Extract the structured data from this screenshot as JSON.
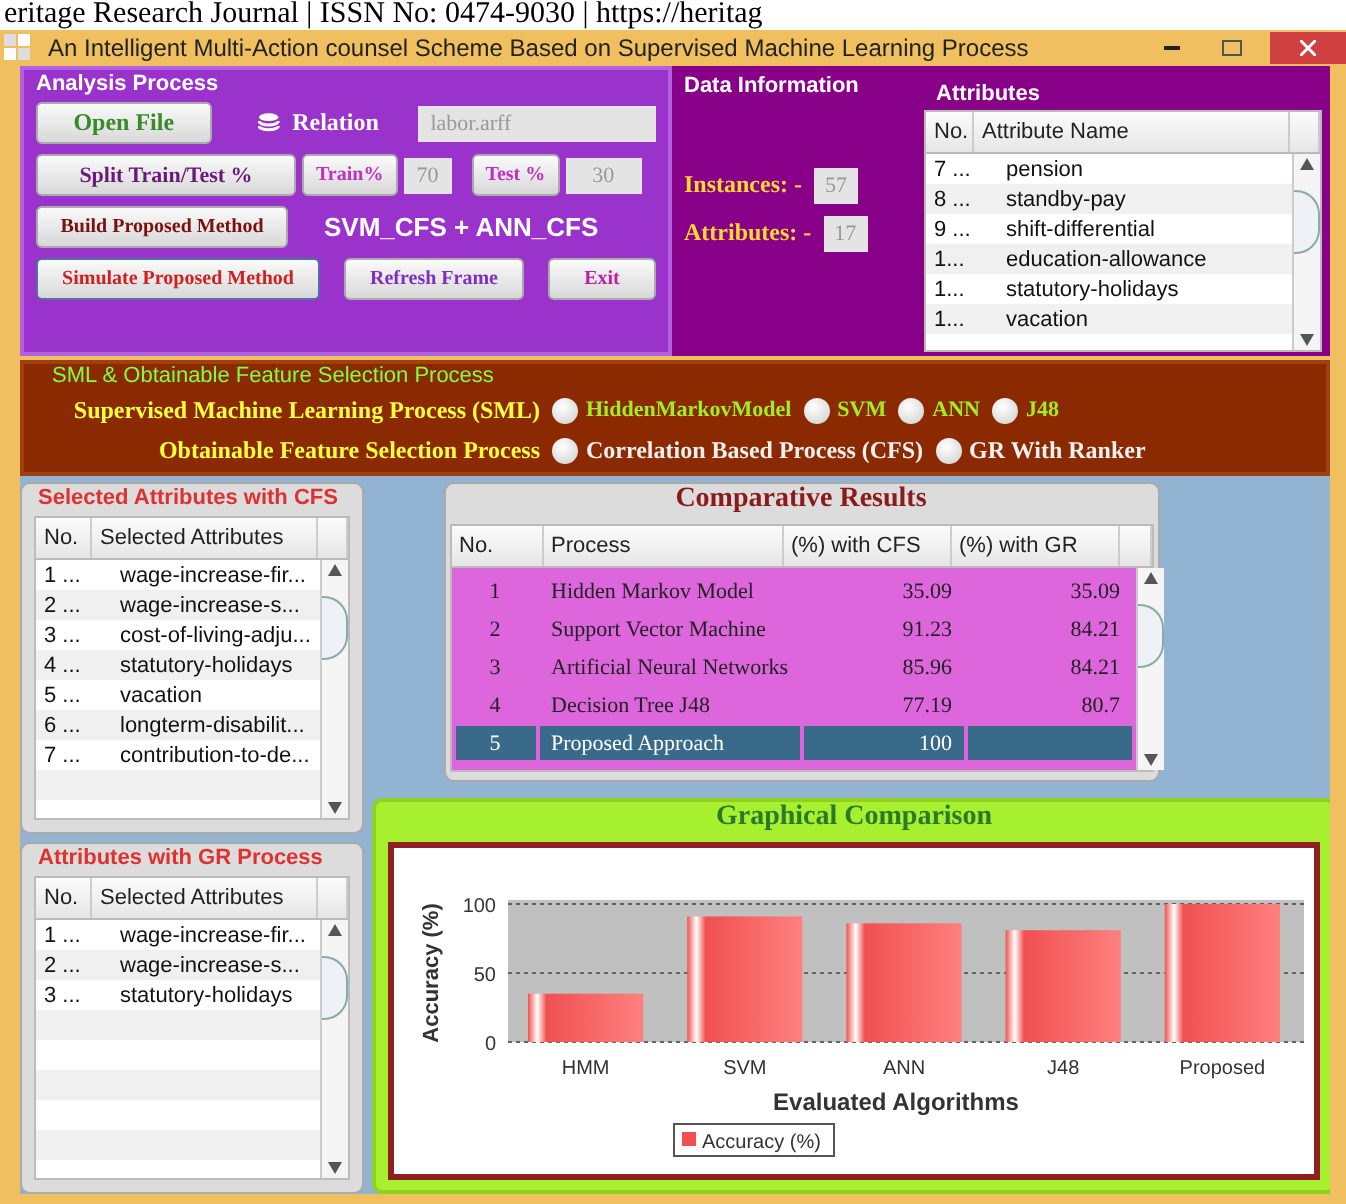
{
  "page_header": "eritage Research Journal | ISSN No: 0474-9030 | https://heritag",
  "window": {
    "title": "An Intelligent Multi-Action counsel Scheme Based on Supervised Machine Learning Process"
  },
  "analysis": {
    "title": "Analysis Process",
    "open_file": "Open File",
    "relation_label": "Relation",
    "relation_value": "labor.arff",
    "split": "Split Train/Test %",
    "train_label": "Train%",
    "train_value": "70",
    "test_label": "Test %",
    "test_value": "30",
    "build": "Build Proposed Method",
    "method": "SVM_CFS + ANN_CFS",
    "simulate": "Simulate Proposed Method",
    "refresh": "Refresh Frame",
    "exit": "Exit"
  },
  "data_info": {
    "title": "Data Information",
    "instances_label": "Instances: -",
    "instances": "57",
    "attributes_label": "Attributes: -",
    "attributes": "17"
  },
  "attributes": {
    "title": "Attributes",
    "columns": [
      "No.",
      "Attribute Name"
    ],
    "rows": [
      [
        "7 ...",
        "pension"
      ],
      [
        "8 ...",
        "standby-pay"
      ],
      [
        "9 ...",
        "shift-differential"
      ],
      [
        "1...",
        "education-allowance"
      ],
      [
        "1...",
        "statutory-holidays"
      ],
      [
        "1...",
        "vacation"
      ]
    ]
  },
  "selection": {
    "title": "SML & Obtainable Feature Selection Process",
    "sml_label": "Supervised Machine Learning Process (SML)",
    "sml_options": [
      {
        "label": "HiddenMarkovModel",
        "selected": false
      },
      {
        "label": "SVM",
        "selected": false
      },
      {
        "label": "ANN",
        "selected": false
      },
      {
        "label": "J48",
        "selected": false
      }
    ],
    "fs_label": "Obtainable Feature Selection Process",
    "fs_options": [
      {
        "label": "Correlation Based Process (CFS)",
        "selected": false
      },
      {
        "label": "GR With Ranker",
        "selected": false
      }
    ]
  },
  "cfs_list": {
    "title": "Selected Attributes with CFS",
    "columns": [
      "No.",
      "Selected Attributes"
    ],
    "rows": [
      [
        "1 ...",
        "wage-increase-fir..."
      ],
      [
        "2 ...",
        "wage-increase-s..."
      ],
      [
        "3 ...",
        "cost-of-living-adju..."
      ],
      [
        "4 ...",
        "statutory-holidays"
      ],
      [
        "5 ...",
        "vacation"
      ],
      [
        "6 ...",
        "longterm-disabilit..."
      ],
      [
        "7 ...",
        "contribution-to-de..."
      ]
    ]
  },
  "gr_list": {
    "title": "Attributes with GR Process",
    "columns": [
      "No.",
      "Selected Attributes"
    ],
    "rows": [
      [
        "1 ...",
        "wage-increase-fir..."
      ],
      [
        "2 ...",
        "wage-increase-s..."
      ],
      [
        "3 ...",
        "statutory-holidays"
      ]
    ]
  },
  "results": {
    "title": "Comparative Results",
    "columns": [
      "No.",
      "Process",
      "(%) with CFS",
      "(%) with GR"
    ],
    "rows": [
      {
        "cells": [
          "1",
          "Hidden Markov Model",
          "35.09",
          "35.09"
        ],
        "selected": false
      },
      {
        "cells": [
          "2",
          "Support Vector Machine",
          "91.23",
          "84.21"
        ],
        "selected": false
      },
      {
        "cells": [
          "3",
          "Artificial Neural Networks",
          "85.96",
          "84.21"
        ],
        "selected": false
      },
      {
        "cells": [
          "4",
          "Decision Tree J48",
          "77.19",
          "80.7"
        ],
        "selected": false
      },
      {
        "cells": [
          "5",
          "Proposed Approach",
          "100"
        ],
        "selected": true
      }
    ]
  },
  "graph": {
    "title": "Graphical Comparison",
    "chart_data": {
      "type": "bar",
      "xlabel": "Evaluated Algorithms",
      "ylabel": "Accuracy (%)",
      "categories": [
        "HMM",
        "SVM",
        "ANN",
        "J48",
        "Proposed"
      ],
      "series": [
        {
          "name": "Accuracy (%)",
          "color": "#f05050",
          "values": [
            35,
            91,
            86,
            81,
            100
          ]
        }
      ],
      "ylim": [
        0,
        100
      ],
      "yticks": [
        0,
        50,
        100
      ]
    }
  }
}
